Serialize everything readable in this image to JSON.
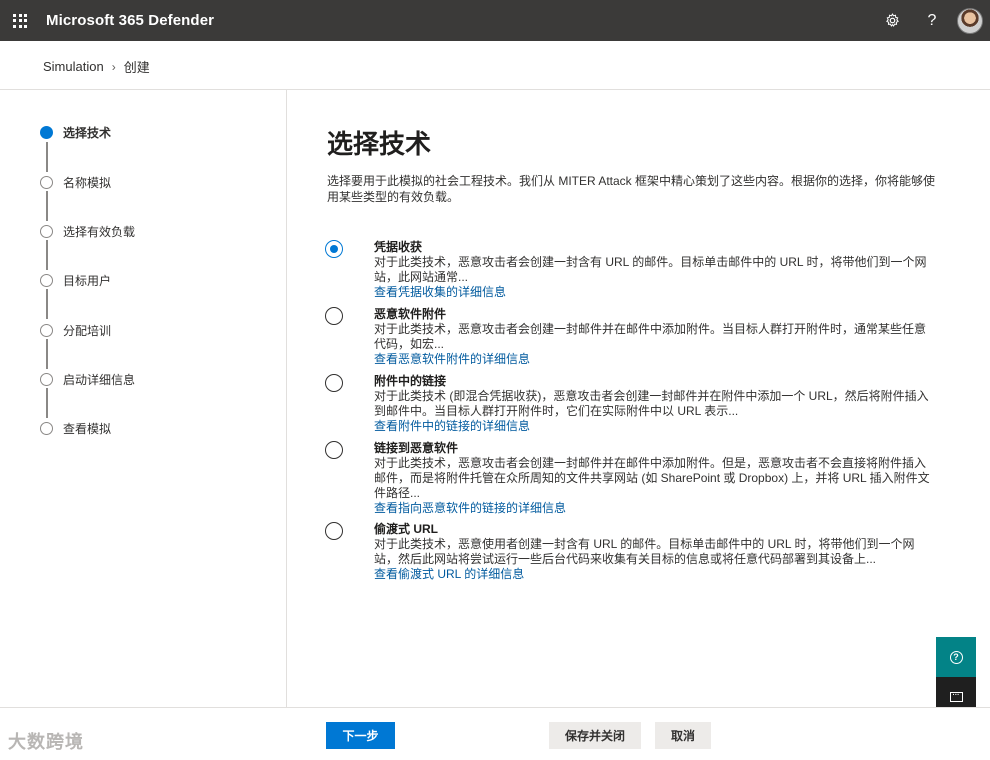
{
  "header": {
    "app_title": "Microsoft 365 Defender",
    "icons": [
      "waffle-icon",
      "gear-icon",
      "help-icon",
      "avatar"
    ]
  },
  "breadcrumb": {
    "items": [
      "Simulation",
      "创建"
    ]
  },
  "steps": [
    {
      "label": "选择技术",
      "active": true
    },
    {
      "label": "名称模拟",
      "active": false
    },
    {
      "label": "选择有效负载",
      "active": false
    },
    {
      "label": "目标用户",
      "active": false
    },
    {
      "label": "分配培训",
      "active": false
    },
    {
      "label": "启动详细信息",
      "active": false
    },
    {
      "label": "查看模拟",
      "active": false
    }
  ],
  "main": {
    "title": "选择技术",
    "description": "选择要用于此模拟的社会工程技术。我们从 MITER Attack 框架中精心策划了这些内容。根据你的选择，你将能够使用某些类型的有效负载。",
    "options": [
      {
        "title": "凭据收获",
        "desc": "对于此类技术，恶意攻击者会创建一封含有 URL 的邮件。目标单击邮件中的 URL 时，将带他们到一个网站，此网站通常...",
        "link": "查看凭据收集的详细信息",
        "checked": true
      },
      {
        "title": "恶意软件附件",
        "desc": "对于此类技术，恶意攻击者会创建一封邮件并在邮件中添加附件。当目标人群打开附件时，通常某些任意代码，如宏...",
        "link": "查看恶意软件附件的详细信息",
        "checked": false
      },
      {
        "title": "附件中的链接",
        "desc": "对于此类技术 (即混合凭据收获)，恶意攻击者会创建一封邮件并在附件中添加一个 URL，然后将附件插入到邮件中。当目标人群打开附件时，它们在实际附件中以 URL 表示...",
        "link": "查看附件中的链接的详细信息",
        "checked": false
      },
      {
        "title": "链接到恶意软件",
        "desc": "对于此类技术，恶意攻击者会创建一封邮件并在邮件中添加附件。但是，恶意攻击者不会直接将附件插入邮件，而是将附件托管在众所周知的文件共享网站 (如 SharePoint 或 Dropbox) 上，并将 URL 插入附件文件路径...",
        "link": "查看指向恶意软件的链接的详细信息",
        "checked": false
      },
      {
        "title": "偷渡式 URL",
        "desc": "对于此类技术，恶意使用者创建一封含有 URL 的邮件。目标单击邮件中的 URL 时，将带他们到一个网站，然后此网站将尝试运行一些后台代码来收集有关目标的信息或将任意代码部署到其设备上...",
        "link": "查看偷渡式 URL 的详细信息",
        "checked": false
      }
    ]
  },
  "footer": {
    "next_label": "下一步",
    "save_close_label": "保存并关闭",
    "cancel_label": "取消"
  },
  "watermark": "大数跨境",
  "colors": {
    "topbar": "#3b3a39",
    "accent": "#0078d4",
    "link": "#005a9e",
    "help_fab": "#038387",
    "chat_fab": "#1f1f1f"
  }
}
